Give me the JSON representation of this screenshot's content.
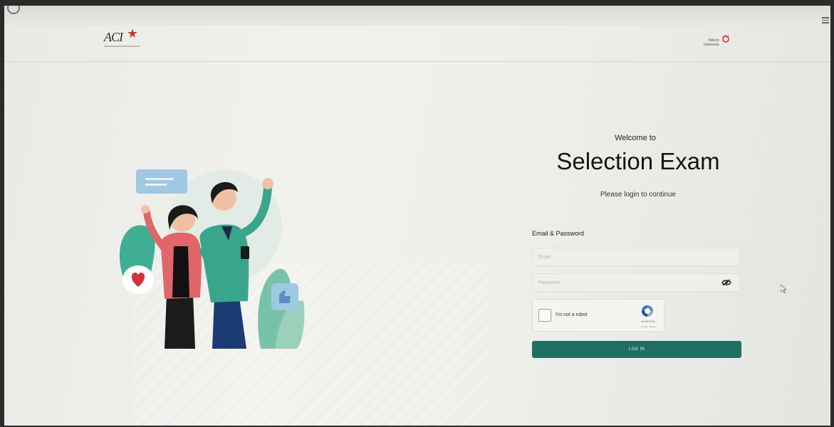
{
  "header": {
    "left_logo": {
      "text": "ACI",
      "accent_color": "#c0392b"
    },
    "right_logo": {
      "line1": "Telkom",
      "line2": "Indonesia",
      "accent_color": "#d63031"
    }
  },
  "welcome_text": "Welcome to",
  "title": "Selection Exam",
  "subtitle": "Please login to continue",
  "form": {
    "section_label": "Email & Password",
    "email": {
      "placeholder": "Email",
      "value": ""
    },
    "password": {
      "placeholder": "Password",
      "value": ""
    },
    "captcha": {
      "label": "I'm not a robot",
      "brand": "reCAPTCHA",
      "links": "Privacy - Terms",
      "checked": false
    },
    "submit_label": "LOG IN"
  },
  "colors": {
    "primary": "#1f6e62",
    "background": "#eeefeb"
  },
  "icons": {
    "password_toggle": "eye-slash-icon",
    "loading": "spinner-icon",
    "menu": "hamburger-icon"
  }
}
